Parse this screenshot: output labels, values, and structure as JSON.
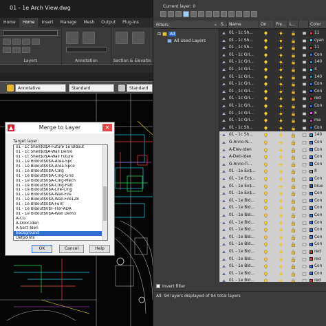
{
  "cad": {
    "title": "01 - 1e Arch View.dwg",
    "ribbon_tabs": [
      "Home",
      "Home",
      "Insert",
      "Manage",
      "Mesh",
      "Output",
      "Plug-ins"
    ],
    "panels": {
      "layers": "Layers",
      "annotation": "Annotation",
      "section": "Section & Elevatio"
    },
    "styles": {
      "annotative": "Annotative",
      "standard_1": "Standard",
      "standard_2": "Standard"
    }
  },
  "dialog": {
    "title": "Merge to Layer",
    "target_label": "Target layer:",
    "items": [
      "01 - 1c Shell$0$A-Future 1e Bldout",
      "01 - 1c Shell$0$A-Wall Demo",
      "01 - 1c Shell$0$A-Wall Future",
      "01 - 1e Bldout$0$A-Area-Spc",
      "01 - 1e Bldout$0$A-Area-Spce",
      "01 - 1e Bldout$0$A-Clng",
      "01 - 1e Bldout$0$A-Clng-Grid",
      "01 - 1e Bldout$0$A-Clng-Mech",
      "01 - 1e Bldout$0$A-Clng-Patt",
      "01 - 1e Bldout$0$A-Life-Clng",
      "01 - 1e Bldout$0$A-Wall-Fire",
      "01 - 1e Bldout$0$A-Wall-Fire128",
      "01 - 1e Bldout$0$A-Furn",
      "01 - 1e Bldout$0$F-Flor-ADA",
      "01 - 1e Bldout$0$A-Wall Demo",
      "A-CG",
      "A-Door-Iden",
      "A-Sect-Iden",
      "background",
      "Defpoints"
    ],
    "selected_index": 18,
    "buttons": {
      "ok": "OK",
      "cancel": "Cancel",
      "help": "Help"
    }
  },
  "panel": {
    "current_layer": "Current layer: 0",
    "filters_title": "Filters",
    "collapse": "«",
    "tree_all": "All",
    "tree_used": "All Used Layers",
    "columns": {
      "status": "S...",
      "name": "Name",
      "on": "On",
      "freeze": "Fre...",
      "lock": "L...",
      "color": "Color"
    },
    "rows": [
      {
        "name": "01 - 1c Sh...",
        "color_name": "11",
        "color": "#ff2a2a",
        "tone": "dark"
      },
      {
        "name": "01 - 1c Sh...",
        "color_name": "cyan",
        "color": "#00e5ff",
        "tone": "dark"
      },
      {
        "name": "01 - 1c Sh...",
        "color_name": "11",
        "color": "#ff2a2a",
        "tone": "dark"
      },
      {
        "name": "01 - 1c Gri...",
        "color_name": "Con",
        "color": "#1a74ff",
        "tone": "dark"
      },
      {
        "name": "01 - 1c Gri...",
        "color_name": "140",
        "color": "#00a0d0",
        "tone": "dark"
      },
      {
        "name": "01 - 1c Gri...",
        "color_name": "4",
        "color": "#00e5ff",
        "tone": "dark"
      },
      {
        "name": "01 - 1c Gri...",
        "color_name": "140",
        "color": "#00a0d0",
        "tone": "dark"
      },
      {
        "name": "01 - 1c Gri...",
        "color_name": "Con",
        "color": "#1a74ff",
        "tone": "dark"
      },
      {
        "name": "01 - 1c Gri...",
        "color_name": "Con",
        "color": "#1a74ff",
        "tone": "dark"
      },
      {
        "name": "01 - 1c Gri...",
        "color_name": "red",
        "color": "#ff1a1a",
        "tone": "dark"
      },
      {
        "name": "01 - 1c Gri...",
        "color_name": "Con",
        "color": "#1a74ff",
        "tone": "dark"
      },
      {
        "name": "01 - 1c Gri...",
        "color_name": "6",
        "color": "#ff44ff",
        "tone": "dark"
      },
      {
        "name": "01 - 1c Gri...",
        "color_name": "ma",
        "color": "#d030d0",
        "tone": "dark"
      },
      {
        "name": "01 - 1c Sh...",
        "color_name": "Con",
        "color": "#1a74ff",
        "tone": "dark"
      },
      {
        "name": "01 - 1c Sh...",
        "color_name": "140",
        "color": "#00a0d0",
        "tone": "light"
      },
      {
        "name": "G-Anno-N...",
        "color_name": "Con",
        "color": "#1a74ff",
        "tone": "light"
      },
      {
        "name": "A-Elev-Iden",
        "color_name": "Con",
        "color": "#1a74ff",
        "tone": "light"
      },
      {
        "name": "A-Detl-Iden",
        "color_name": "Con",
        "color": "#1a74ff",
        "tone": "light"
      },
      {
        "name": "G-Anno-Ti...",
        "color_name": "Con",
        "color": "#1a74ff",
        "tone": "light"
      },
      {
        "name": "01 - 1e Ex$...",
        "color_name": "8",
        "color": "#9a9a9a",
        "tone": "light"
      },
      {
        "name": "01 - 1e Ex$...",
        "color_name": "Con",
        "color": "#1a74ff",
        "tone": "light"
      },
      {
        "name": "01 - 1e Ex$...",
        "color_name": "blue",
        "color": "#1a3cff",
        "tone": "light"
      },
      {
        "name": "01 - 1e Ex$...",
        "color_name": "Con",
        "color": "#1a74ff",
        "tone": "light"
      },
      {
        "name": "01 - 1e Bld...",
        "color_name": "Con",
        "color": "#1a74ff",
        "tone": "light"
      },
      {
        "name": "01 - 1e Bld...",
        "color_name": "Con",
        "color": "#1a74ff",
        "tone": "light"
      },
      {
        "name": "01 - 1e Bld...",
        "color_name": "Con",
        "color": "#1a74ff",
        "tone": "light"
      },
      {
        "name": "01 - 1e Bld...",
        "color_name": "Con",
        "color": "#1a74ff",
        "tone": "light"
      },
      {
        "name": "01 - 1e Bld...",
        "color_name": "Con",
        "color": "#1a74ff",
        "tone": "light"
      },
      {
        "name": "01 - 1e Bld...",
        "color_name": "Con",
        "color": "#1a74ff",
        "tone": "light"
      },
      {
        "name": "01 - 1e Bld...",
        "color_name": "Con",
        "color": "#1a74ff",
        "tone": "light"
      },
      {
        "name": "01 - 1e Bld...",
        "color_name": "red",
        "color": "#ff1a1a",
        "tone": "light"
      },
      {
        "name": "01 - 1e Bld...",
        "color_name": "red",
        "color": "#ff1a1a",
        "tone": "light"
      },
      {
        "name": "01 - 1e Bld...",
        "color_name": "Con",
        "color": "#1a74ff",
        "tone": "light"
      },
      {
        "name": "01 - 1e Bld...",
        "color_name": "Con",
        "color": "#1a74ff",
        "tone": "light"
      },
      {
        "name": "01 - 1e Bld...",
        "color_name": "red",
        "color": "#ff1a1a",
        "tone": "light"
      }
    ],
    "invert_filter": "Invert filter",
    "status": "All: 94 layers displayed of 94 total layers"
  }
}
